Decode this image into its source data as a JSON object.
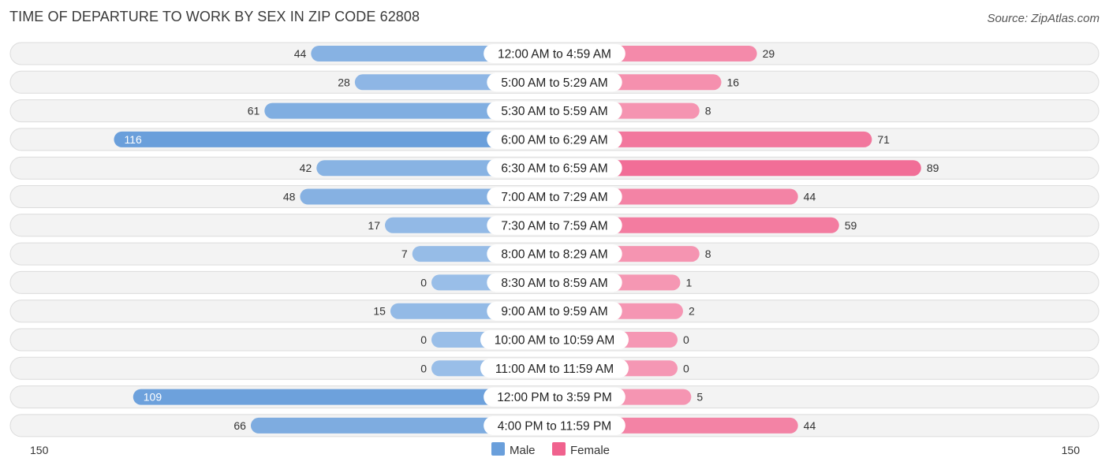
{
  "chart_data": {
    "type": "bar",
    "orientation": "horizontal-diverging",
    "title": "TIME OF DEPARTURE TO WORK BY SEX IN ZIP CODE 62808",
    "source": "Source: ZipAtlas.com",
    "categories": [
      "12:00 AM to 4:59 AM",
      "5:00 AM to 5:29 AM",
      "5:30 AM to 5:59 AM",
      "6:00 AM to 6:29 AM",
      "6:30 AM to 6:59 AM",
      "7:00 AM to 7:29 AM",
      "7:30 AM to 7:59 AM",
      "8:00 AM to 8:29 AM",
      "8:30 AM to 8:59 AM",
      "9:00 AM to 9:59 AM",
      "10:00 AM to 10:59 AM",
      "11:00 AM to 11:59 AM",
      "12:00 PM to 3:59 PM",
      "4:00 PM to 11:59 PM"
    ],
    "series": [
      {
        "name": "Male",
        "color": "#6a9fdb",
        "light_color": "#a9c8ec",
        "values": [
          44,
          28,
          61,
          116,
          42,
          48,
          17,
          7,
          0,
          15,
          0,
          0,
          109,
          66
        ]
      },
      {
        "name": "Female",
        "color": "#f0628e",
        "light_color": "#f7a9c0",
        "values": [
          29,
          16,
          8,
          71,
          89,
          44,
          59,
          8,
          1,
          2,
          0,
          0,
          5,
          44
        ]
      }
    ],
    "axis": {
      "left_label": "150",
      "right_label": "150",
      "max": 150
    },
    "legend": {
      "position": "bottom-center",
      "items": [
        "Male",
        "Female"
      ]
    },
    "grid": false
  }
}
